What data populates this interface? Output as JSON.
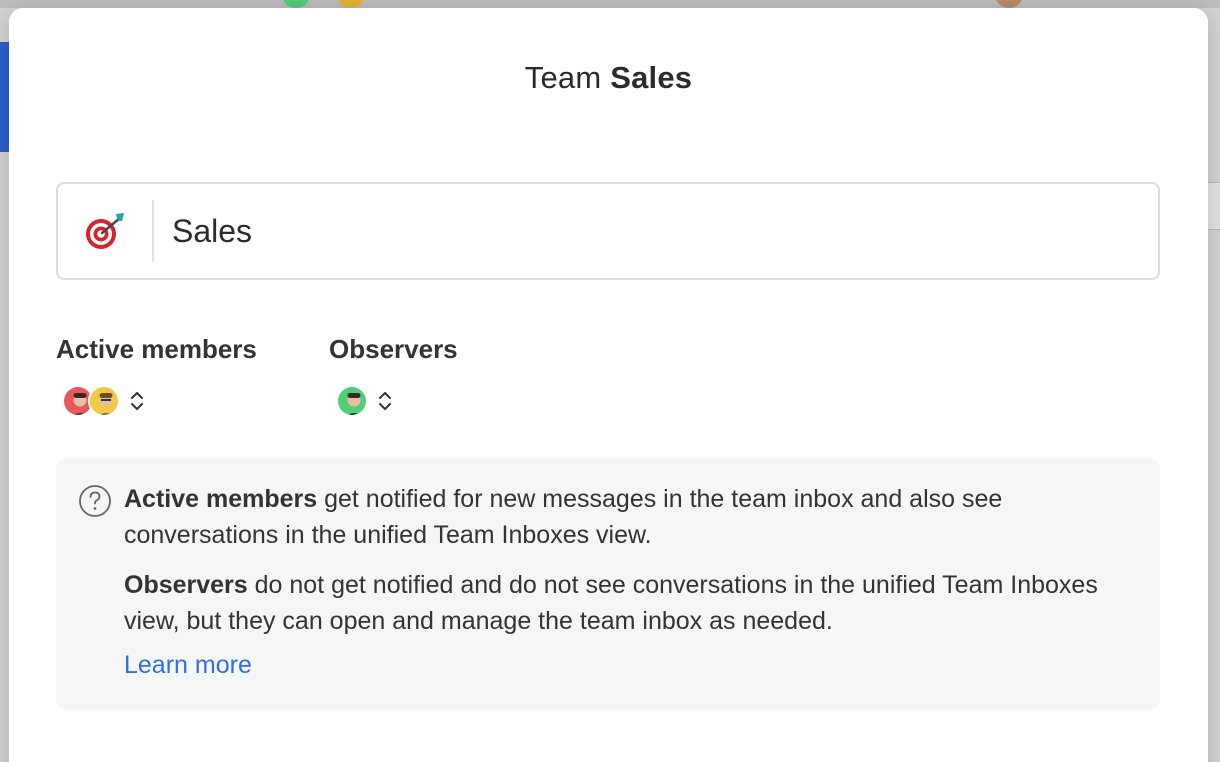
{
  "modal": {
    "title_prefix": "Team",
    "title_name": "Sales"
  },
  "name_field": {
    "emoji_icon": "dart-target-icon",
    "value": "Sales"
  },
  "active_members": {
    "label": "Active members",
    "avatars": [
      "avatar-red",
      "avatar-yellow"
    ]
  },
  "observers": {
    "label": "Observers",
    "avatars": [
      "avatar-green"
    ]
  },
  "info": {
    "active_bold": "Active members",
    "active_text": " get notified for new messages in the team inbox and also see conversations in the unified Team Inboxes view.",
    "observers_bold": "Observers",
    "observers_text": " do not get notified and do not see conversations in the unified Team Inboxes view, but they can open and manage the team inbox as needed.",
    "learn_more": "Learn more"
  },
  "colors": {
    "accent_link": "#2f6fe0",
    "avatar_red": "#e8585d",
    "avatar_yellow": "#f5c842",
    "avatar_green": "#4fcf7a"
  }
}
